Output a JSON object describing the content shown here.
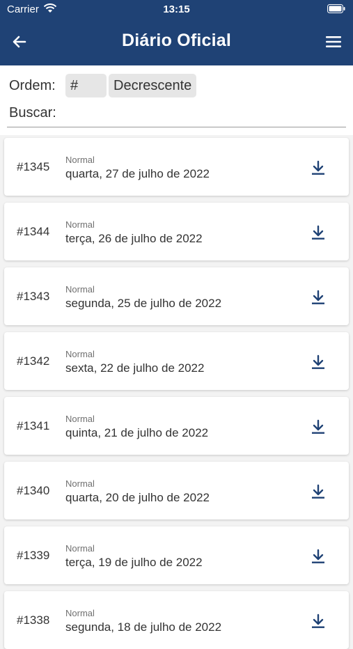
{
  "status_bar": {
    "carrier": "Carrier",
    "time": "13:15"
  },
  "header": {
    "title": "Diário Oficial",
    "back_icon": "arrow-left-icon",
    "menu_icon": "hamburger-menu-icon"
  },
  "filters": {
    "order_label": "Ordem:",
    "order_field": "#",
    "order_direction": "Decrescente",
    "search_label": "Buscar:",
    "search_value": ""
  },
  "colors": {
    "header_bg": "#1f4275",
    "icon": "#1f4275"
  },
  "editions": [
    {
      "number": "#1345",
      "type": "Normal",
      "date": "quarta, 27 de julho de 2022"
    },
    {
      "number": "#1344",
      "type": "Normal",
      "date": "terça, 26 de julho de 2022"
    },
    {
      "number": "#1343",
      "type": "Normal",
      "date": "segunda, 25 de julho de 2022"
    },
    {
      "number": "#1342",
      "type": "Normal",
      "date": "sexta, 22 de julho de 2022"
    },
    {
      "number": "#1341",
      "type": "Normal",
      "date": "quinta, 21 de julho de 2022"
    },
    {
      "number": "#1340",
      "type": "Normal",
      "date": "quarta, 20 de julho de 2022"
    },
    {
      "number": "#1339",
      "type": "Normal",
      "date": "terça, 19 de julho de 2022"
    },
    {
      "number": "#1338",
      "type": "Normal",
      "date": "segunda, 18 de julho de 2022"
    }
  ]
}
